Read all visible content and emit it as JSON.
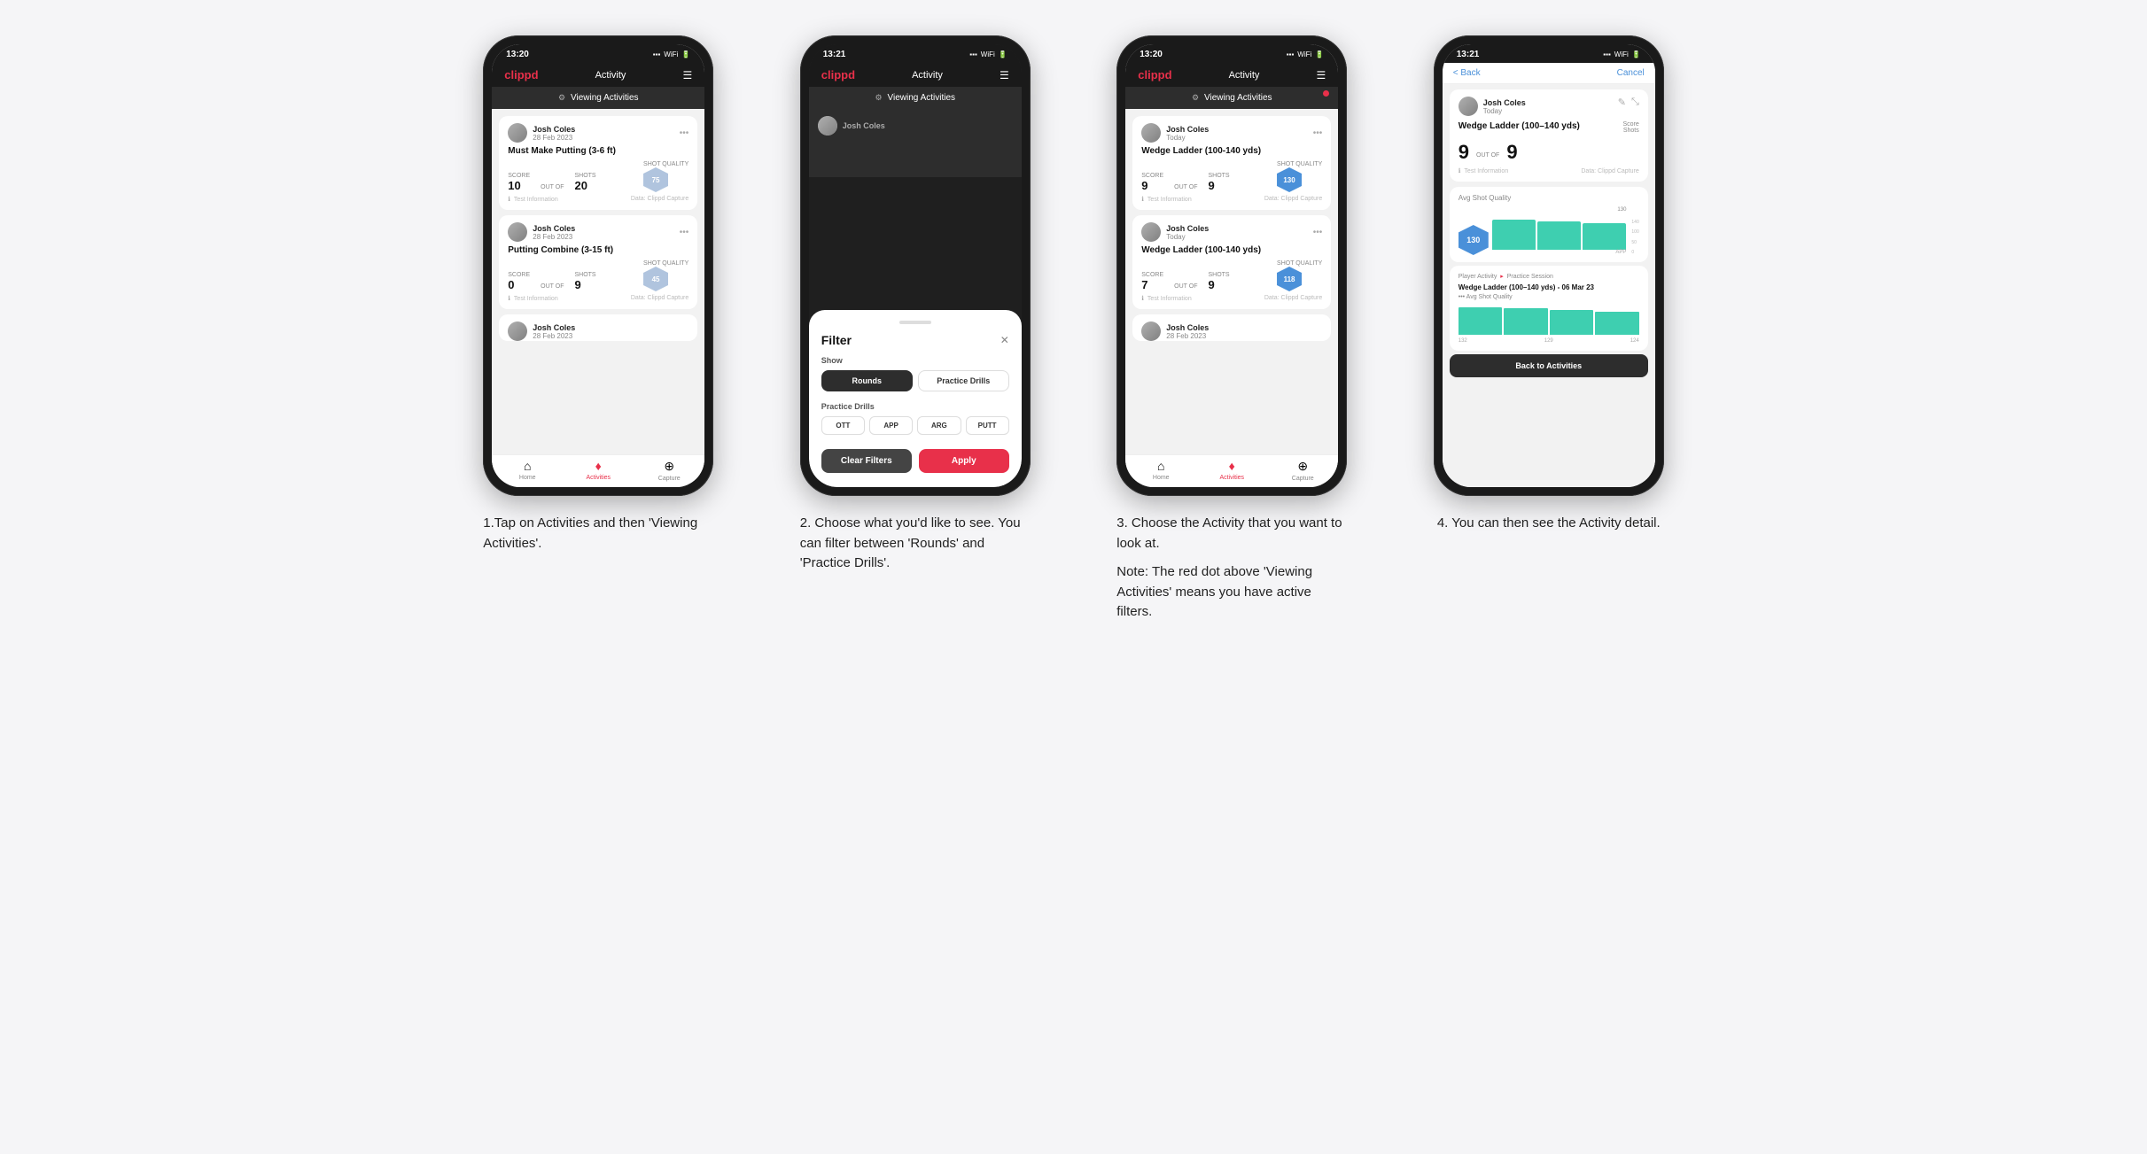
{
  "app": {
    "logo": "clippd",
    "nav_title": "Activity",
    "status_time_1": "13:20",
    "status_time_2": "13:21",
    "status_time_3": "13:20",
    "status_time_4": "13:21"
  },
  "banner": {
    "text": "Viewing Activities",
    "icon": "⚙"
  },
  "phone1": {
    "cards": [
      {
        "user": "Josh Coles",
        "date": "28 Feb 2023",
        "title": "Must Make Putting (3-6 ft)",
        "score_label": "Score",
        "shots_label": "Shots",
        "sq_label": "Shot Quality",
        "score": "10",
        "shots": "20",
        "sq": "75",
        "info": "Test Information",
        "data": "Data: Clippd Capture"
      },
      {
        "user": "Josh Coles",
        "date": "28 Feb 2023",
        "title": "Putting Combine (3-15 ft)",
        "score_label": "Score",
        "shots_label": "Shots",
        "sq_label": "Shot Quality",
        "score": "0",
        "shots": "9",
        "sq": "45",
        "info": "Test Information",
        "data": "Data: Clippd Capture"
      },
      {
        "user": "Josh Coles",
        "date": "28 Feb 2023",
        "title": "",
        "score": "",
        "shots": "",
        "sq": ""
      }
    ],
    "bottom_nav": [
      {
        "label": "Home",
        "icon": "⌂",
        "active": false
      },
      {
        "label": "Activities",
        "icon": "♦",
        "active": true
      },
      {
        "label": "Capture",
        "icon": "⊕",
        "active": false
      }
    ]
  },
  "phone2": {
    "filter_title": "Filter",
    "show_label": "Show",
    "rounds_label": "Rounds",
    "practice_drills_label": "Practice Drills",
    "drills_section_label": "Practice Drills",
    "drill_types": [
      "OTT",
      "APP",
      "ARG",
      "PUTT"
    ],
    "clear_label": "Clear Filters",
    "apply_label": "Apply"
  },
  "phone3": {
    "cards": [
      {
        "user": "Josh Coles",
        "date": "Today",
        "title": "Wedge Ladder (100-140 yds)",
        "score_label": "Score",
        "shots_label": "Shots",
        "sq_label": "Shot Quality",
        "score": "9",
        "shots": "9",
        "sq": "130",
        "sq_color": "blue",
        "info": "Test Information",
        "data": "Data: Clippd Capture"
      },
      {
        "user": "Josh Coles",
        "date": "Today",
        "title": "Wedge Ladder (100-140 yds)",
        "score_label": "Score",
        "shots_label": "Shots",
        "sq_label": "Shot Quality",
        "score": "7",
        "shots": "9",
        "sq": "118",
        "sq_color": "blue",
        "info": "Test Information",
        "data": "Data: Clippd Capture"
      },
      {
        "user": "Josh Coles",
        "date": "28 Feb 2023",
        "title": "",
        "score": "",
        "shots": "",
        "sq": ""
      }
    ],
    "bottom_nav": [
      {
        "label": "Home",
        "icon": "⌂",
        "active": false
      },
      {
        "label": "Activities",
        "icon": "♦",
        "active": true
      },
      {
        "label": "Capture",
        "icon": "⊕",
        "active": false
      }
    ]
  },
  "phone4": {
    "back_label": "< Back",
    "cancel_label": "Cancel",
    "user": "Josh Coles",
    "date": "Today",
    "drill_title": "Wedge Ladder (100–140 yds)",
    "score_label": "Score",
    "shots_label": "Shots",
    "score": "9",
    "shots": "9",
    "out_of": "OUT OF",
    "avg_sq_label": "Avg Shot Quality",
    "chart_label": "130",
    "chart_y_labels": [
      "140",
      "100",
      "50",
      "0"
    ],
    "chart_x_label": "APP",
    "chart_bars": [
      {
        "value": 132,
        "color": "#3ecfb0",
        "label": "132"
      },
      {
        "value": 129,
        "color": "#3ecfb0",
        "label": "129"
      },
      {
        "value": 124,
        "color": "#3ecfb0",
        "label": "124"
      }
    ],
    "player_activity_label": "Player Activity",
    "practice_session_label": "Practice Session",
    "session_title": "Wedge Ladder (100–140 yds) - 06 Mar 23",
    "session_subtitle": "••• Avg Shot Quality",
    "back_to_activities": "Back to Activities",
    "info_label": "Test Information",
    "data_label": "Data: Clippd Capture"
  },
  "captions": [
    {
      "text": "1.Tap on Activities and then 'Viewing Activities'."
    },
    {
      "text": "2. Choose what you'd like to see. You can filter between 'Rounds' and 'Practice Drills'."
    },
    {
      "text": "3. Choose the Activity that you want to look at.",
      "note": "Note: The red dot above 'Viewing Activities' means you have active filters."
    },
    {
      "text": "4. You can then see the Activity detail."
    }
  ]
}
